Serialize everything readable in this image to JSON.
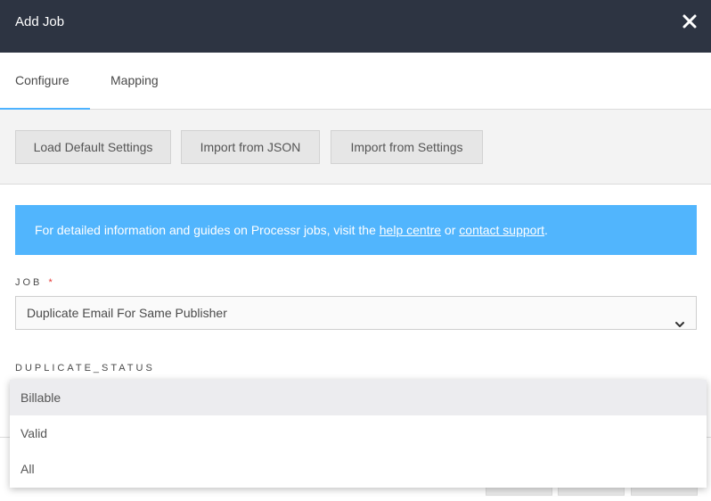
{
  "header": {
    "title": "Add Job",
    "close_icon": "close-icon"
  },
  "tabs": [
    {
      "label": "Configure",
      "active": true
    },
    {
      "label": "Mapping",
      "active": false
    }
  ],
  "toolbar": {
    "load_default": "Load Default Settings",
    "import_json": "Import from JSON",
    "import_settings": "Import from Settings"
  },
  "info": {
    "text_before": "For detailed information and guides on Processr jobs, visit the ",
    "help_link": "help centre",
    "text_mid": " or ",
    "support_link": "contact support",
    "text_after": "."
  },
  "form": {
    "job_label": "JOB",
    "required_mark": "*",
    "job_value": "Duplicate Email For Same Publisher",
    "duplicate_status_label": "DUPLICATE_STATUS"
  },
  "dropdown": {
    "options": [
      "Billable",
      "Valid",
      "All"
    ],
    "highlighted": "Billable"
  },
  "colors": {
    "header_bg": "#2d3442",
    "accent": "#4db3ff",
    "info_bg": "#51b5fd",
    "required": "#e53935"
  }
}
